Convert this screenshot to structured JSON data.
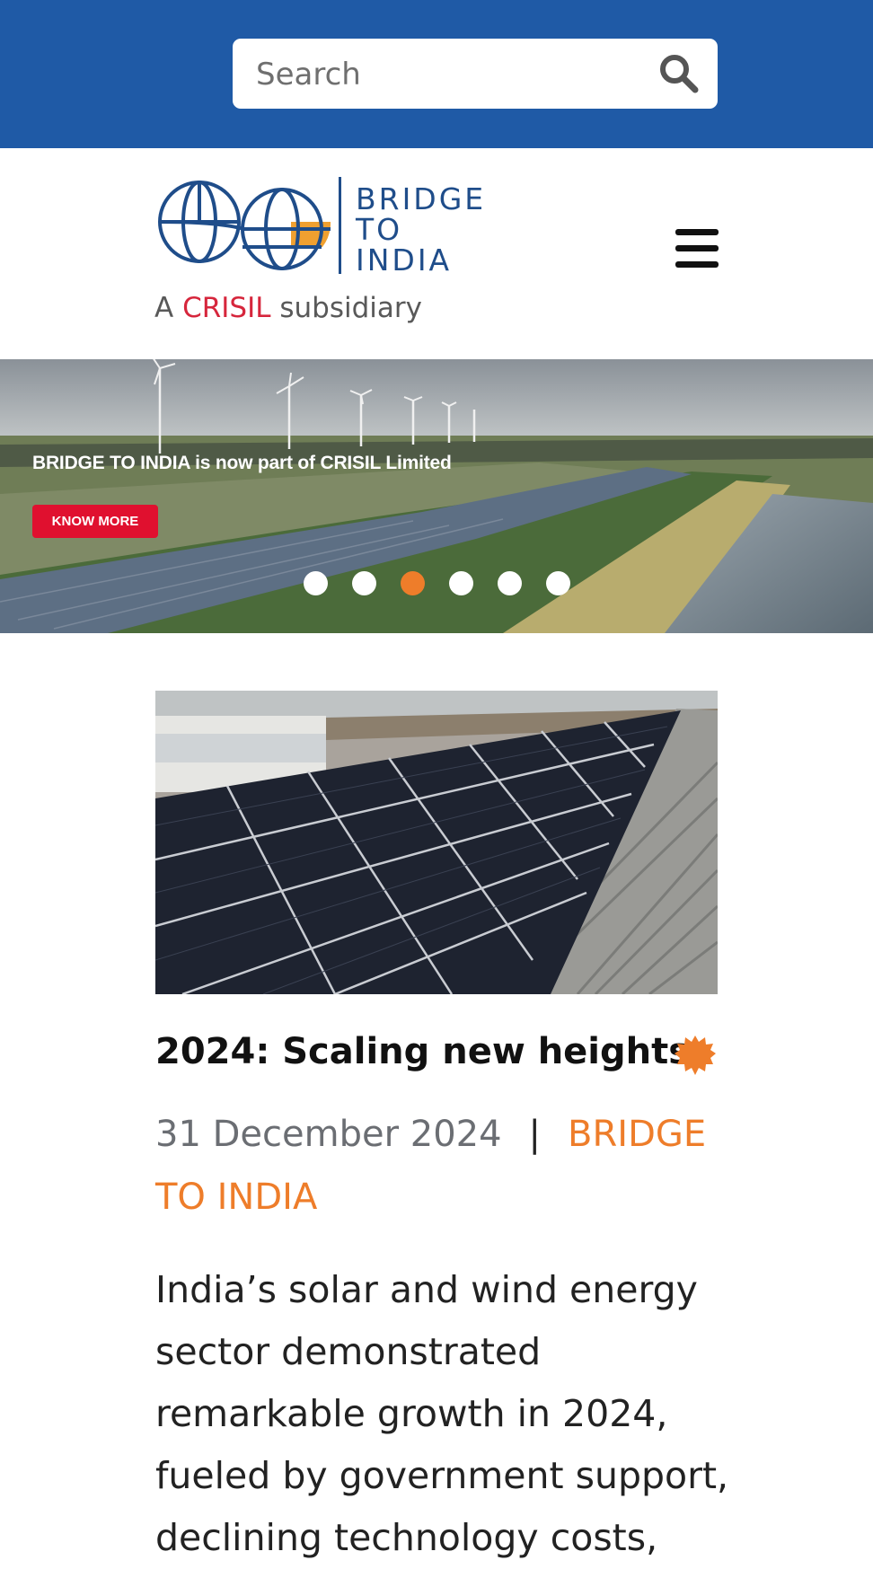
{
  "search": {
    "placeholder": "Search"
  },
  "brand": {
    "line1": "BRIDGE",
    "line2": "TO",
    "line3": "INDIA",
    "subsidiary_prefix": "A ",
    "subsidiary_brand": "CRISIL",
    "subsidiary_suffix": " subsidiary"
  },
  "banner": {
    "caption": "BRIDGE TO INDIA is now part of CRISIL Limited",
    "cta": "KNOW MORE",
    "slides": 6,
    "active_slide": 3
  },
  "article": {
    "title": "2024: Scaling new heights",
    "date": "31 December 2024",
    "separator": "|",
    "author": "BRIDGE TO INDIA",
    "excerpt": "India’s solar and wind energy sector demonstrated remarkable growth in 2024, fueled by government support, declining technology costs,"
  },
  "colors": {
    "topbar": "#1f5aa6",
    "accent": "#ee7d2a",
    "brand_blue": "#1f4d8a",
    "crisil_red": "#d6263c"
  },
  "icons": {
    "search": "search-icon",
    "menu": "hamburger-menu-icon",
    "badge": "starburst-icon"
  }
}
